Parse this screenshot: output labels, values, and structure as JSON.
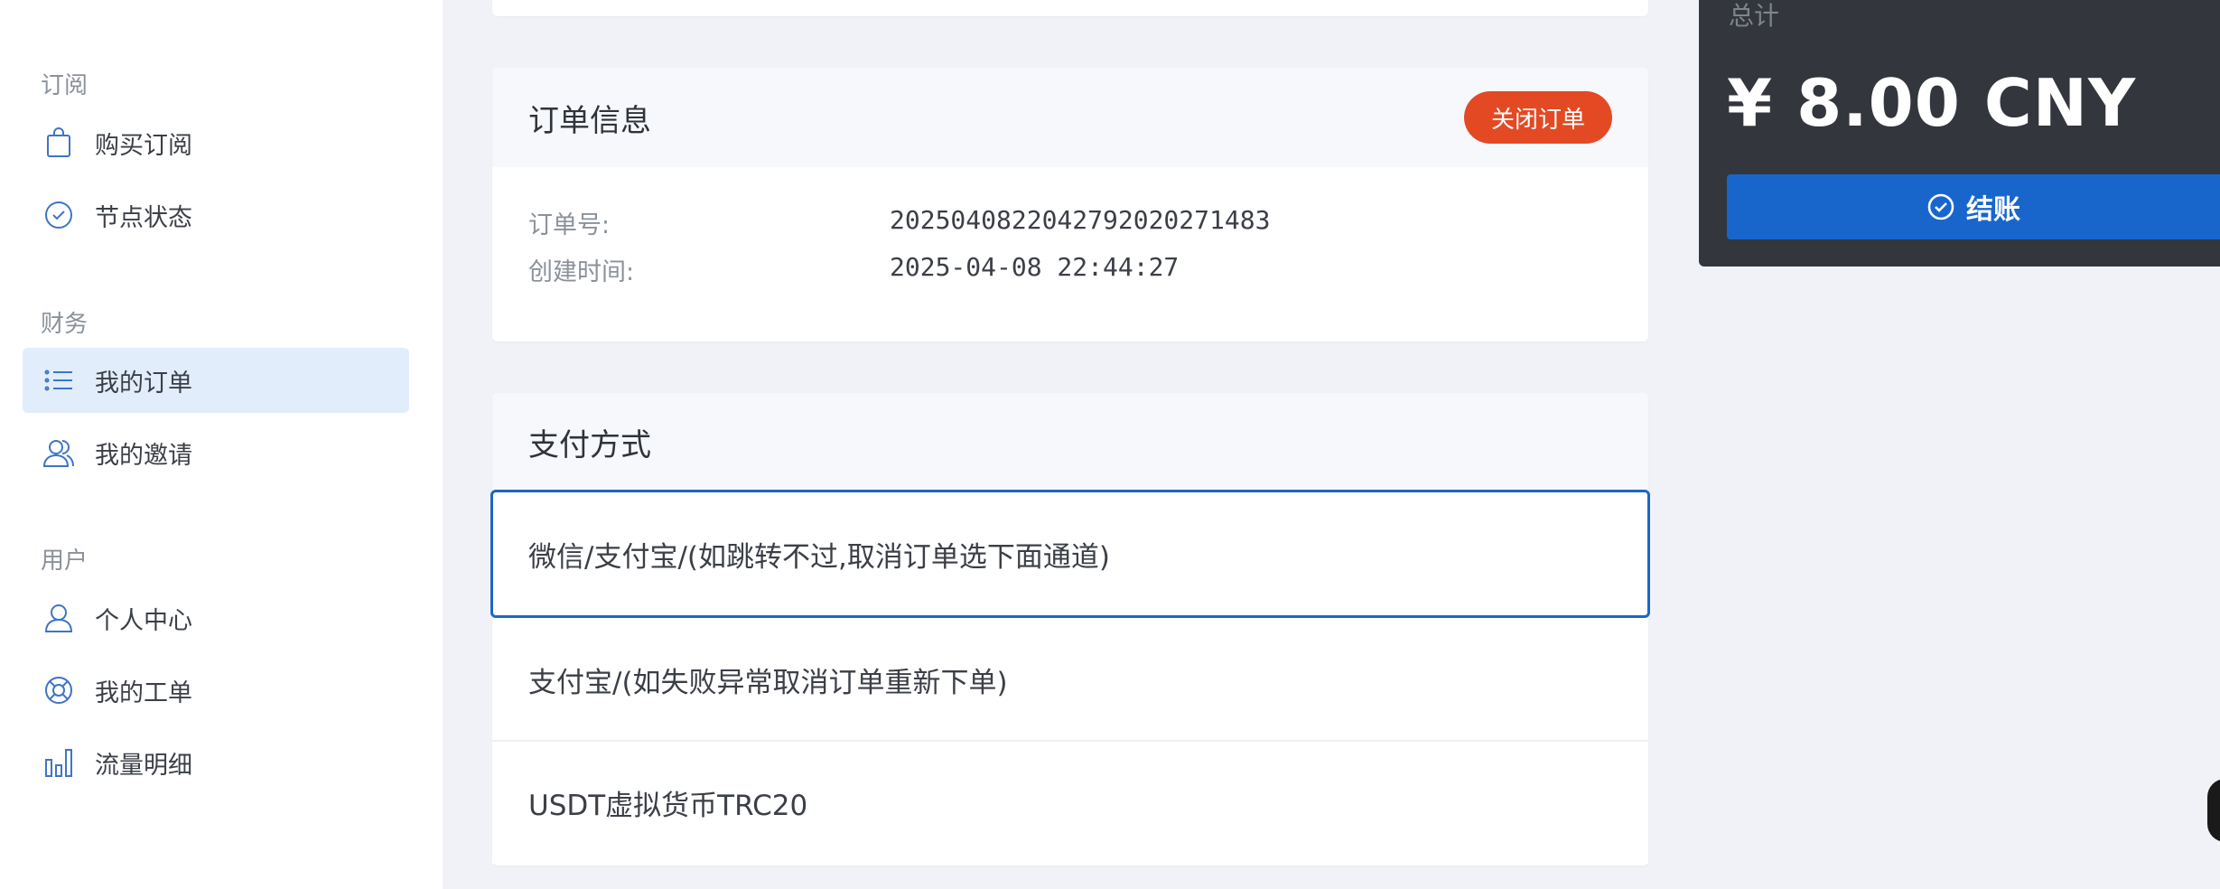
{
  "sidebar": {
    "sections": [
      {
        "title": "订阅",
        "items": [
          {
            "label": "购买订阅",
            "icon": "shopping-bag-icon"
          },
          {
            "label": "节点状态",
            "icon": "check-circle-icon"
          }
        ]
      },
      {
        "title": "财务",
        "items": [
          {
            "label": "我的订单",
            "icon": "list-icon",
            "active": true
          },
          {
            "label": "我的邀请",
            "icon": "users-icon"
          }
        ]
      },
      {
        "title": "用户",
        "items": [
          {
            "label": "个人中心",
            "icon": "user-icon"
          },
          {
            "label": "我的工单",
            "icon": "lifebuoy-icon"
          },
          {
            "label": "流量明细",
            "icon": "bar-chart-icon"
          }
        ]
      }
    ]
  },
  "order_info": {
    "title": "订单信息",
    "close_button": "关闭订单",
    "order_no_label": "订单号:",
    "order_no_value": "2025040822042792020271483",
    "created_label": "创建时间:",
    "created_value": "2025-04-08 22:44:27"
  },
  "payment": {
    "title": "支付方式",
    "options": [
      {
        "label": "微信/支付宝/(如跳转不过,取消订单选下面通道)",
        "selected": true
      },
      {
        "label": "支付宝/(如失败异常取消订单重新下单)",
        "selected": false
      },
      {
        "label": "USDT虚拟货币TRC20",
        "selected": false
      }
    ]
  },
  "summary": {
    "total_label": "总计",
    "total_amount": "¥ 8.00 CNY",
    "checkout_label": "结账",
    "checkout_icon": "check-circle-icon"
  },
  "colors": {
    "accent": "#1866cc",
    "danger": "#e34a24",
    "summary_bg": "#33363c",
    "active_item_bg": "#e1edfb"
  }
}
